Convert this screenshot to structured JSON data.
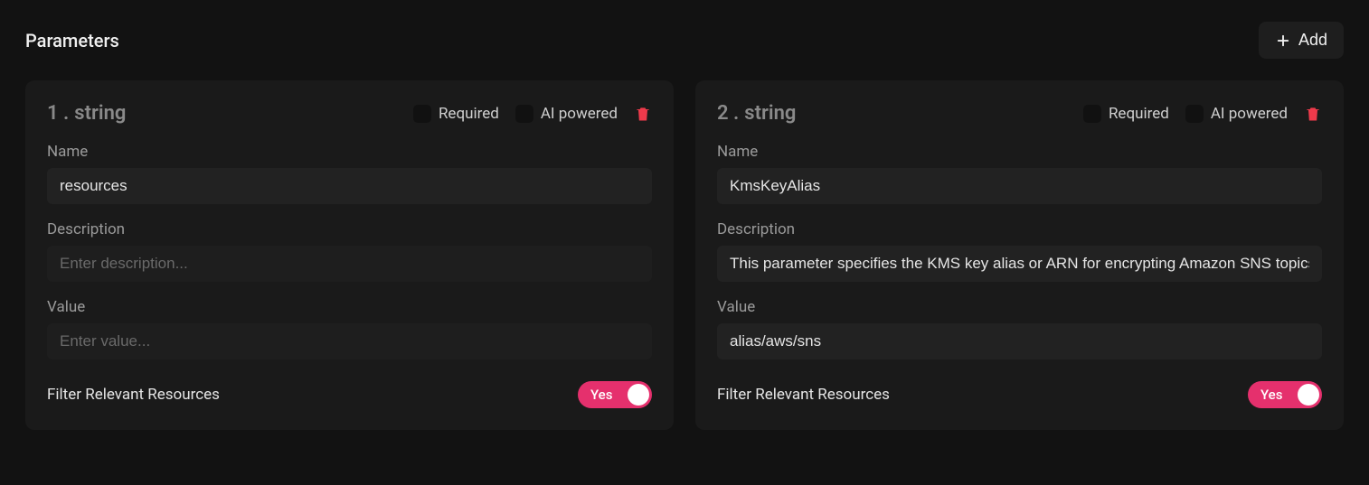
{
  "header": {
    "title": "Parameters",
    "add_label": "Add"
  },
  "labels": {
    "required": "Required",
    "ai_powered": "AI powered",
    "name": "Name",
    "description": "Description",
    "value": "Value",
    "filter_relevant": "Filter Relevant Resources",
    "toggle_yes": "Yes",
    "desc_placeholder": "Enter description...",
    "value_placeholder": "Enter value..."
  },
  "params": [
    {
      "index": "1 .",
      "type": "string",
      "required": false,
      "ai_powered": false,
      "name": "resources",
      "description": "",
      "value": "",
      "filter": true
    },
    {
      "index": "2 .",
      "type": "string",
      "required": false,
      "ai_powered": false,
      "name": "KmsKeyAlias",
      "description": "This parameter specifies the KMS key alias or ARN for encrypting Amazon SNS topics.",
      "value": "alias/aws/sns",
      "filter": true
    }
  ]
}
